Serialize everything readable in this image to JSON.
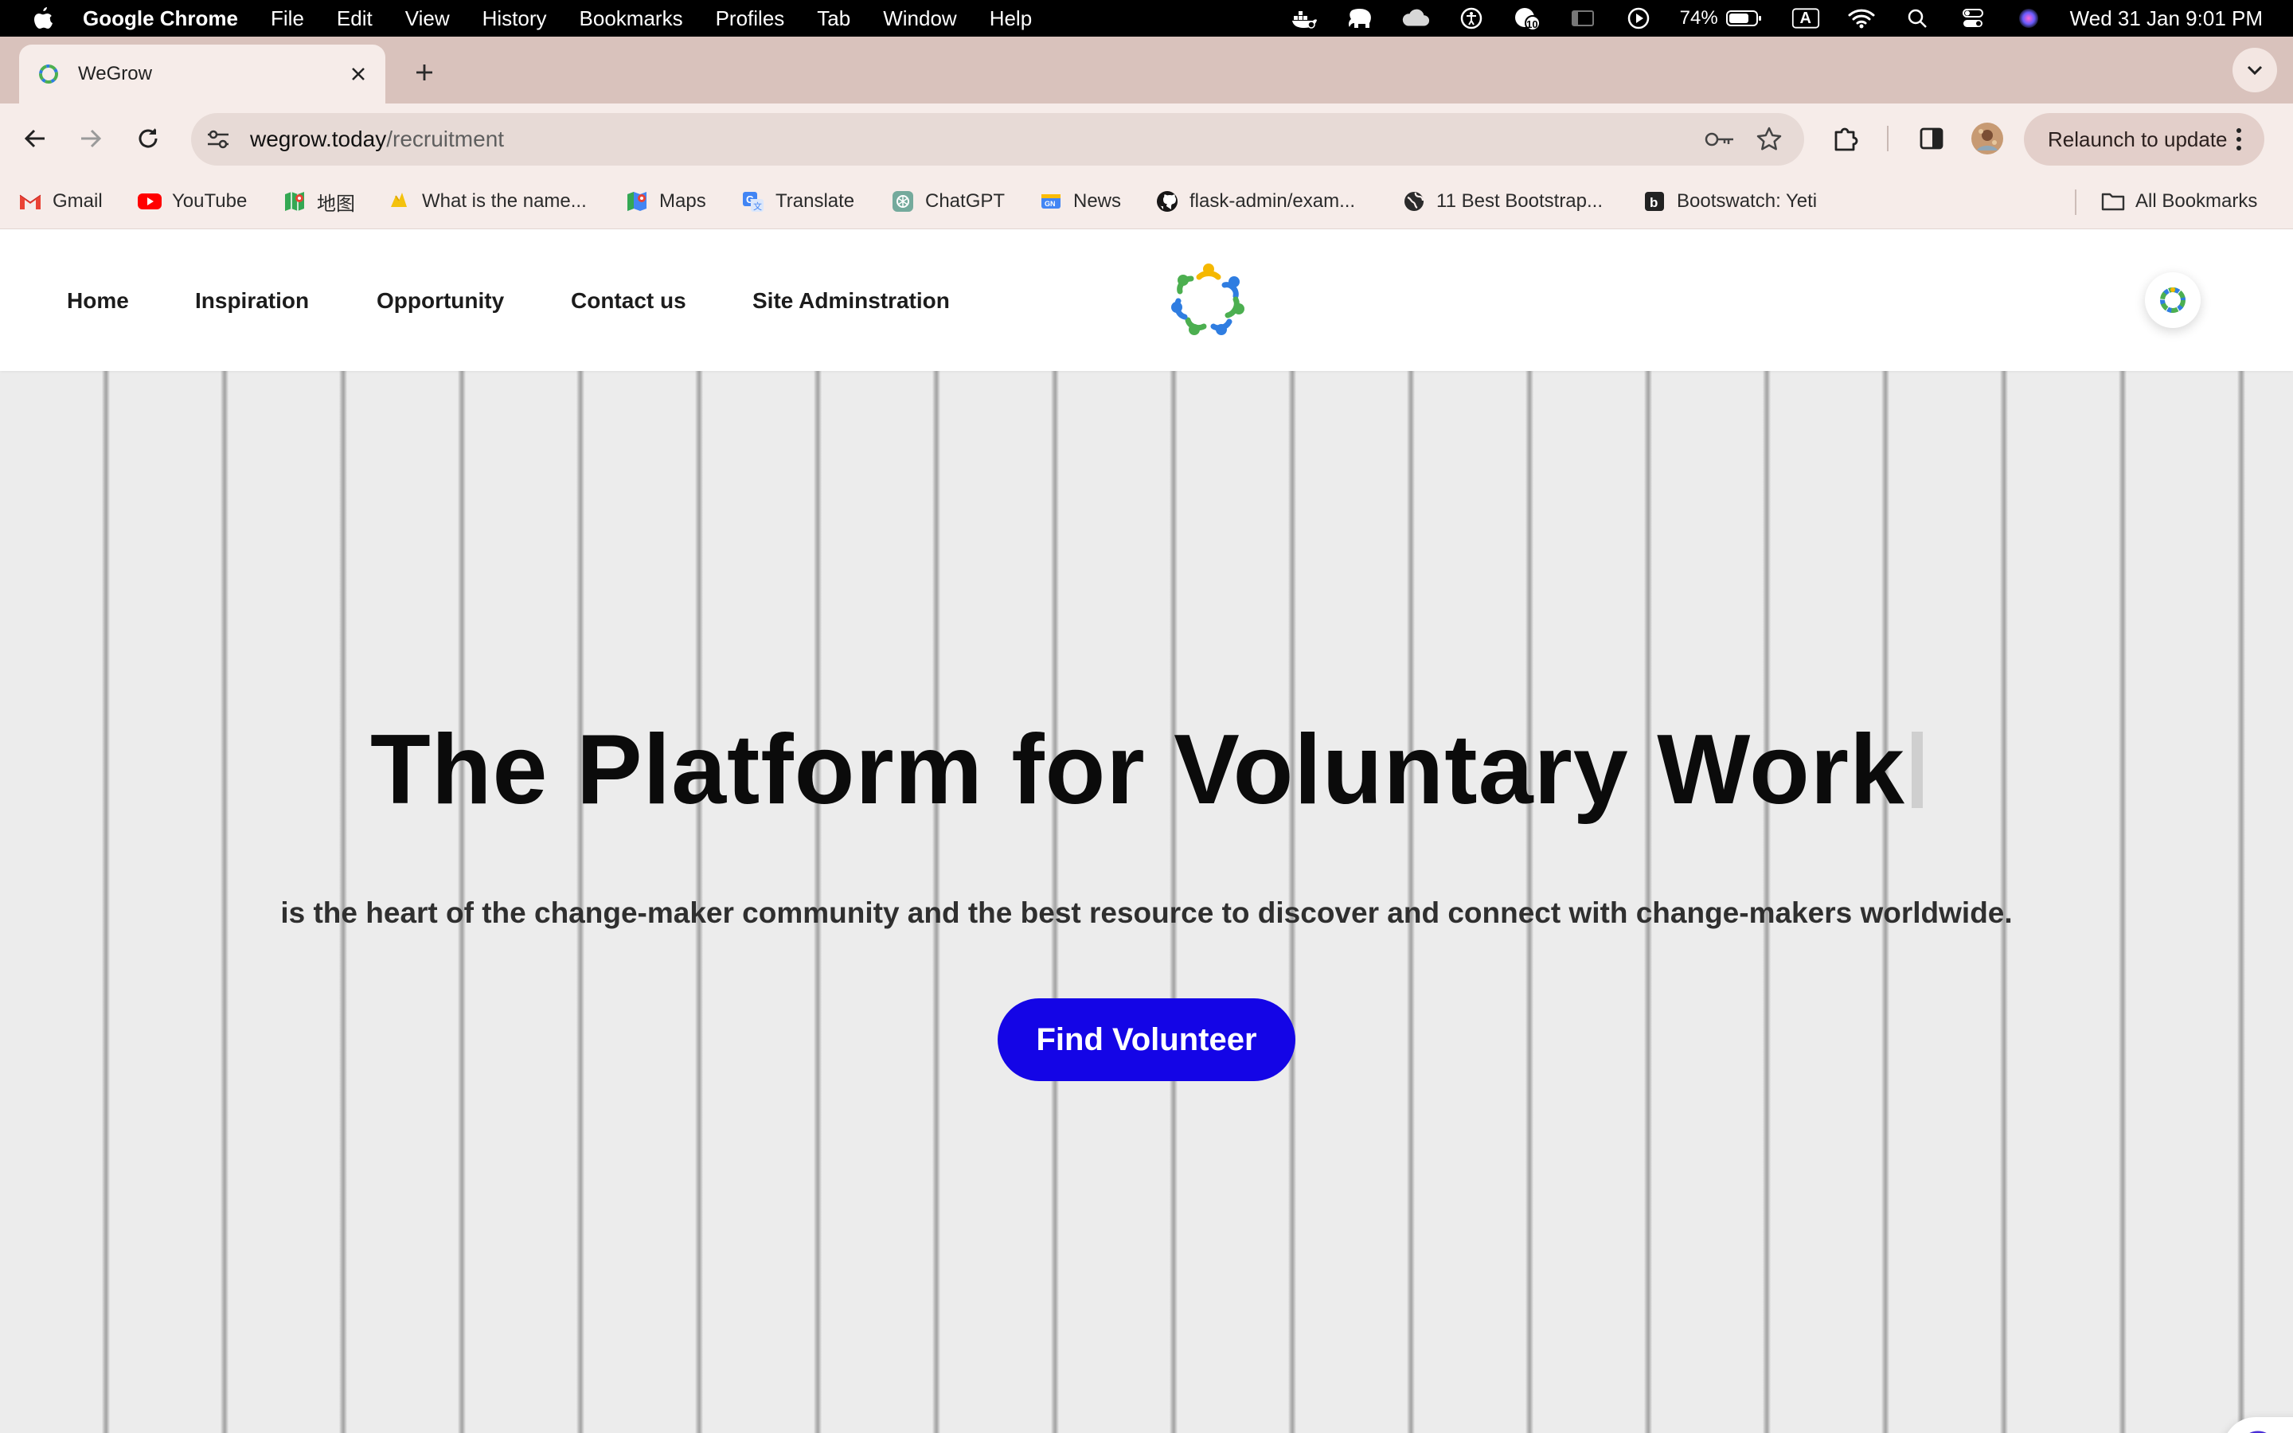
{
  "menubar": {
    "app_name": "Google Chrome",
    "items": [
      "File",
      "Edit",
      "View",
      "History",
      "Bookmarks",
      "Profiles",
      "Tab",
      "Window",
      "Help"
    ],
    "battery_percent": "74%",
    "input_source": "A",
    "notification_count": "10",
    "clock": "Wed 31 Jan  9:01 PM"
  },
  "tabs": [
    {
      "title": "WeGrow"
    }
  ],
  "toolbar": {
    "url_host": "wegrow.today",
    "url_path": "/recruitment",
    "relaunch_label": "Relaunch to update"
  },
  "bookmarks": {
    "items": [
      {
        "label": "Gmail",
        "icon": "gmail-icon"
      },
      {
        "label": "YouTube",
        "icon": "youtube-icon"
      },
      {
        "label": "地图",
        "icon": "maps-icon"
      },
      {
        "label": "What is the name...",
        "icon": "bookmark-icon"
      },
      {
        "label": "Maps",
        "icon": "maps-icon"
      },
      {
        "label": "Translate",
        "icon": "translate-icon"
      },
      {
        "label": "ChatGPT",
        "icon": "chatgpt-icon"
      },
      {
        "label": "News",
        "icon": "news-icon"
      },
      {
        "label": "flask-admin/exam...",
        "icon": "github-icon"
      },
      {
        "label": "11 Best Bootstrap...",
        "icon": "globe-icon"
      },
      {
        "label": "Bootswatch: Yeti",
        "icon": "bootswatch-icon"
      }
    ],
    "all_bookmarks_label": "All Bookmarks"
  },
  "site": {
    "nav": [
      {
        "label": "Home"
      },
      {
        "label": "Inspiration"
      },
      {
        "label": "Opportunity"
      },
      {
        "label": "Contact us"
      },
      {
        "label": "Site Adminstration"
      }
    ],
    "hero": {
      "title": "The Platform for Voluntary Work",
      "subtitle": "is the heart of the change-maker community and the best resource to discover and connect with change-makers worldwide.",
      "cta_label": "Find Volunteer"
    }
  },
  "colors": {
    "cta_background": "#1405e6",
    "tab_strip": "#d9c2bc",
    "toolbar": "#f6ece9",
    "logo_green": "#4caf50",
    "logo_blue": "#2f7de1",
    "logo_yellow": "#f5b800"
  }
}
